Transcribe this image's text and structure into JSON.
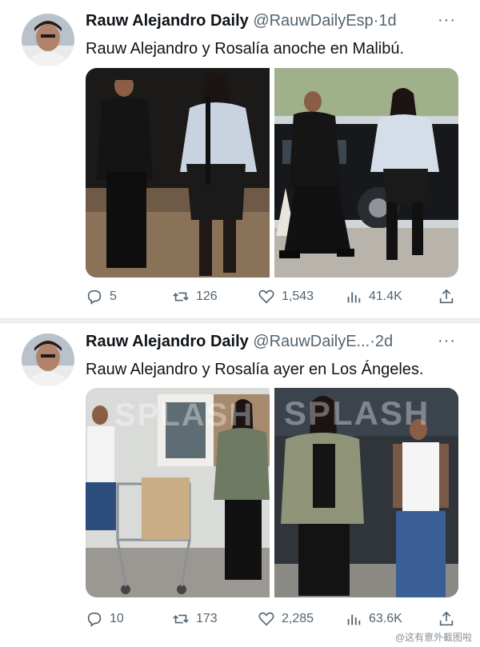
{
  "tweets": [
    {
      "account_name": "Rauw Alejandro Daily",
      "handle": "@RauwDailyEsp",
      "separator": "·",
      "time": "1d",
      "more": "···",
      "text": "Rauw Alejandro y Rosalía anoche en Malibú.",
      "stats": {
        "replies": "5",
        "reposts": "126",
        "likes": "1,543",
        "views": "41.4K"
      }
    },
    {
      "account_name": "Rauw Alejandro Daily",
      "handle": "@RauwDailyE...",
      "separator": "·",
      "time": "2d",
      "more": "···",
      "text": "Rauw Alejandro y Rosalía ayer en Los Ángeles.",
      "stats": {
        "replies": "10",
        "reposts": "173",
        "likes": "2,285",
        "views": "63.6K"
      },
      "photo_watermark_left": "SPLASH",
      "photo_watermark_right": "SPLASH"
    }
  ],
  "footer_watermark": "@这有意外截图啦",
  "icons": [
    "reply-icon",
    "repost-icon",
    "like-icon",
    "views-icon",
    "share-icon",
    "more-icon"
  ],
  "colors": {
    "text": "#0f1419",
    "secondary": "#536471",
    "divider": "#eef0f2"
  }
}
